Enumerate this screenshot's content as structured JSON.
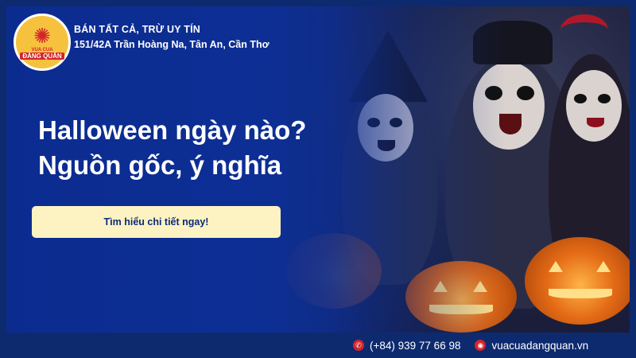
{
  "brand": {
    "logo_line1": "VUA CUA",
    "logo_line2": "ĐĂNG QUÂN",
    "tagline": "BÁN TẤT CẢ, TRỪ UY TÍN",
    "address": "151/42A Trần Hoàng Na, Tân An, Cần Thơ"
  },
  "headline": {
    "line1": "Halloween ngày nào?",
    "line2": "Nguồn gốc, ý nghĩa"
  },
  "cta": {
    "label": "Tìm hiểu chi tiết ngay!"
  },
  "contact": {
    "phone": "(+84) 939 77 66 98",
    "phone_icon": "phone-icon",
    "website": "vuacuadangquan.vn",
    "website_icon": "globe-icon"
  },
  "colors": {
    "background": "#0d2a7a",
    "cta_background": "#fdf3c2",
    "accent": "#d3242b",
    "logo_bg": "#f6c23e"
  }
}
